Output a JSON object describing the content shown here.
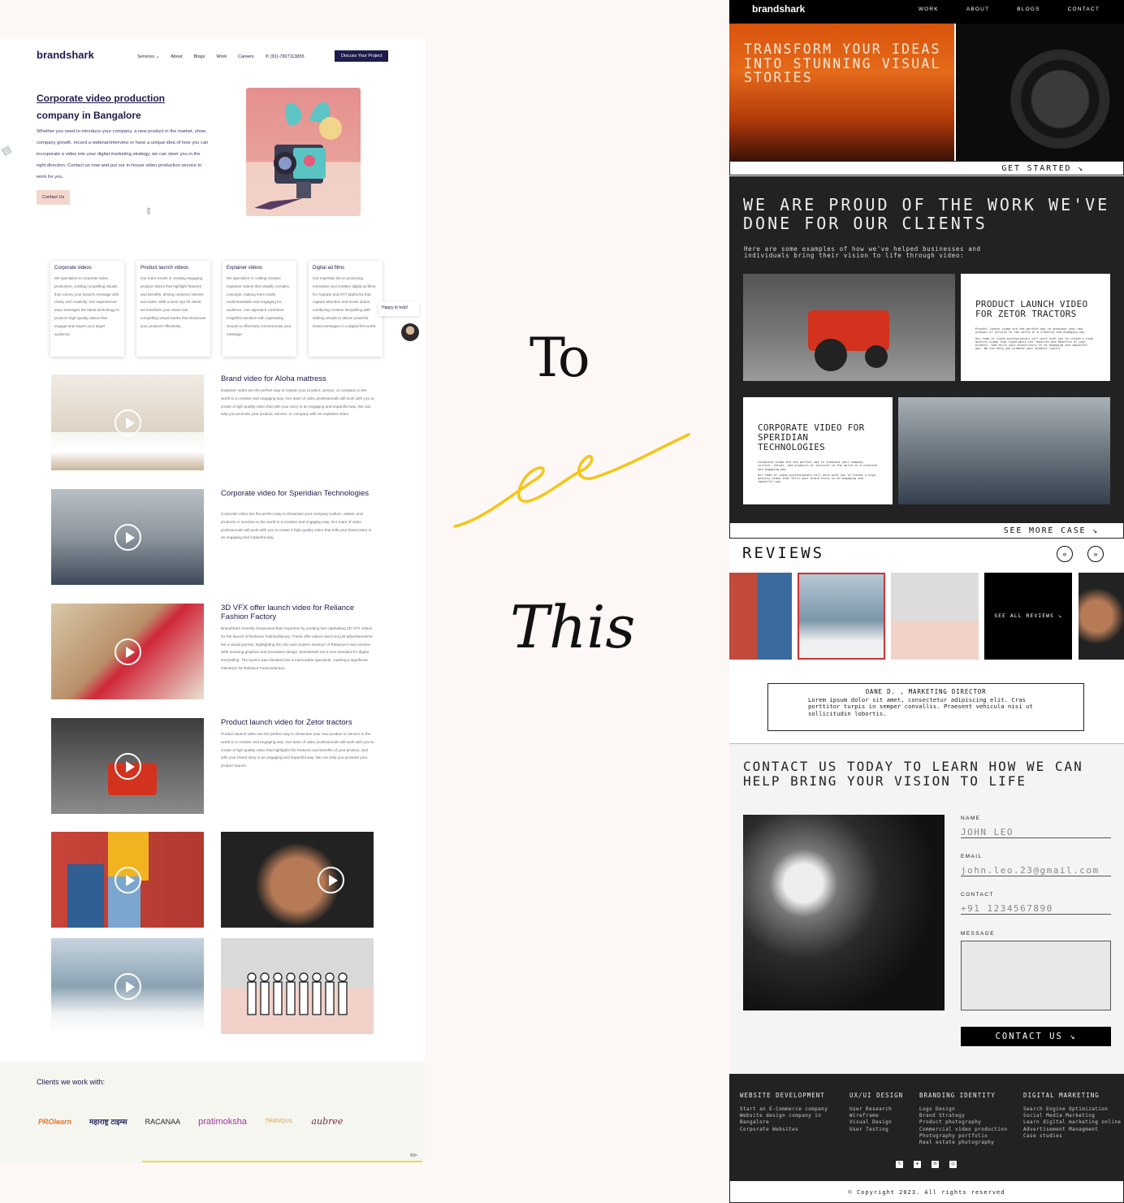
{
  "old_site": {
    "logo": "brandshark",
    "nav": [
      "Services ⌄",
      "About",
      "Blogs",
      "Work",
      "Careers",
      "(91)-7827113855"
    ],
    "cta": "Discuss Your Project",
    "hero_title_1": "Corporate video production",
    "hero_title_2": "company in Bangalore",
    "hero_text": "Whether you need to introduce your company, a new product in the market, show company growth, record a webinar/interview or have a unique idea of how you can incorporate a video into your digital marketing strategy, we can steer you in the right direction. Contact us now and put our in-house video production service to work for you.",
    "contact_button": "Contact Us",
    "cards": [
      {
        "title": "Corporate videos",
        "text": "We specialize in corporate video production, crafting compelling visuals that convey your brand's message with clarity and creativity. Our experienced team leverages the latest technology to produce high-quality videos that engage and inspire your target audience."
      },
      {
        "title": "Product launch videos",
        "text": "Our team excels in creating engaging product videos that highlight features and benefits, driving customer interest and sales. With a keen eye for detail, we transform your vision into compelling visual stories that showcase your products effectively."
      },
      {
        "title": "Explainer videos",
        "text": "We specialize in crafting creative explainer videos that simplify complex concepts, making them easily understandable and engaging for audience. Our approach combines insightful narrative with captivating visuals to effectively communicate your message."
      },
      {
        "title": "Digital ad films",
        "text": "Our expertise lies in producing innovative and creative digital ad films for Youtube and OTT platforms that capture attention and evoke action, combining creative storytelling with striking visuals to deliver powerful brand messages in a digital-first world."
      }
    ],
    "chat": "Happy to help!",
    "videos": [
      {
        "title": "Brand video for Aloha mattress",
        "text": "Explainer video are the perfect way to explain your product, service, or company to the world in a creative and engaging way. Our team of video professionals will work with you to create a high-quality video that tells your story in an engaging and impactful way. We can help you promote your product, service, or company with an explainer video."
      },
      {
        "title": "Corporate video for Speridian Technologies",
        "text": "Corporate video are the perfect way to showcase your company culture, values, and products or services to the world in a creative and engaging way. Our team of video professionals will work with you to create a high-quality video that tells your brand story in an engaging and impactful way."
      },
      {
        "title": "3D VFX offer launch video for Reliance Fashion Factory",
        "text": "Brandshark recently showcased their expertise by creating two captivating 3D VFX videos for the launch of Reliance Fashionfactory. These offer videos went not just advertisements but a visual journey, highlighting the chic and modern essence of Reliance's new venture. With stunning graphics and innovative design, Brandshark set a new standard for digital storytelling. The launch was elevated into a memorable spectacle, marking a significant milestone for Reliance Fashionfactory."
      },
      {
        "title": "Product launch video for Zetor tractors",
        "text": "Product launch video are the perfect way to showcase your new product or service to the world in a creative and engaging way. Our team of video professionals will work with you to create a high-quality video that highlights the features and benefits of your product, and tells your brand story in an engaging and impactful way. We can help you promote your product launch."
      }
    ],
    "clients_title": "Clients we work with:",
    "client_logos": [
      "PROlearn",
      "महाराष्ट्र टाइम्स",
      "RACANAA",
      "pratimoksha",
      "TRANQUIL",
      "aubree"
    ]
  },
  "middle": {
    "to": "To",
    "this": "This"
  },
  "new_site": {
    "logo": "brandshark",
    "nav": [
      "WORK",
      "ABOUT",
      "BLOGS",
      "CONTACT"
    ],
    "hero_title": "TRANSFORM YOUR IDEAS INTO STUNNING VISUAL STORIES",
    "get_started": "GET STARTED ↘",
    "work_title": "WE ARE PROUD OF THE WORK WE'VE DONE FOR OUR CLIENTS",
    "work_sub": "Here are some examples of how we've helped businesses and individuals bring their vision to life through video:",
    "cases": [
      {
        "title": "PRODUCT LAUNCH VIDEO FOR ZETOR TRACTORS",
        "text1": "Product launch video are the perfect way to showcase your new product or service to the world in a creative and engaging way.",
        "text2": "Our team of video professionals will work with you to create a high-quality video that highlights the features and benefits of your product, and tells your brand story in an engaging and impactful way. We can help you promote your product launch."
      },
      {
        "title": "CORPORATE VIDEO FOR SPERIDIAN TECHNOLOGIES",
        "text1": "Corporate video are the perfect way to showcase your company culture, values, and products or services to the world in a creative and engaging way.",
        "text2": "Our team of video professionals will work with you to create a high-quality video that tells your brand story in an engaging and impactful way."
      }
    ],
    "see_more": "SEE MORE CASE ↘",
    "reviews_title": "REVIEWS",
    "see_all": "SEE ALL REVIEWS ↘",
    "review_author": "OANE D. , MARKETING DIRECTOR",
    "review_text": "Lorem ipsum dolor sit amet, consectetur adipiscing elit. Cras porttitor turpis in semper convallis. Praesent vehicula nisi ut sollicitudin lobortis.",
    "contact_title": "CONTACT US TODAY TO LEARN HOW WE CAN HELP BRING YOUR VISION TO LIFE",
    "form": {
      "name_label": "NAME",
      "name_value": "JOHN LEO",
      "email_label": "EMAIL",
      "email_value": "john.leo.23@gmail.com",
      "contact_label": "CONTACT",
      "contact_value": "+91 1234567890",
      "message_label": "MESSAGE",
      "button": "CONTACT US ↘"
    },
    "footer": [
      {
        "title": "WEBSITE DEVELOPMENT",
        "items": [
          "Start an E-Commerce company",
          "Website design company in",
          "Bangalore",
          "Corporate Websites"
        ]
      },
      {
        "title": "UX/UI DESIGN",
        "items": [
          "User Research",
          "Wireframe",
          "Visual Design",
          "User Testing"
        ]
      },
      {
        "title": "BRANDING IDENTITY",
        "items": [
          "Logo Design",
          "Brand Strategy",
          "Product photography",
          "Commercial video production",
          "Photography portfolio",
          "Real estate photography"
        ]
      },
      {
        "title": "DIGITAL MARKETING",
        "items": [
          "Search Engine Optimization",
          "Social Media Marketing",
          "Learn digital marketing online",
          "Advertisement Managment",
          "Case studies"
        ]
      }
    ],
    "social": [
      "x-icon",
      "medium-icon",
      "linkedin-icon",
      "instagram-icon"
    ],
    "copyright": "© Copyright 2023. All rights reserved"
  },
  "colors": {
    "old_brand": "#1f1b4d",
    "old_accent": "#f4d6cc",
    "new_dark": "#222222",
    "squiggle": "#f5c518"
  }
}
